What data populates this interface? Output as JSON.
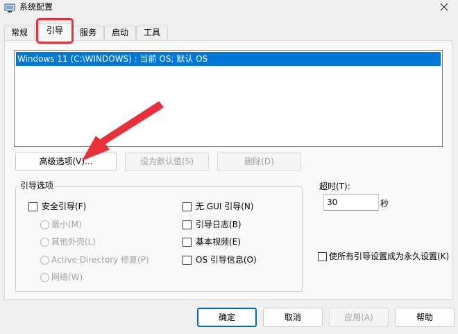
{
  "window": {
    "title": "系统配置"
  },
  "tabs": [
    {
      "label": "常规"
    },
    {
      "label": "引导"
    },
    {
      "label": "服务"
    },
    {
      "label": "启动"
    },
    {
      "label": "工具"
    }
  ],
  "boot_list": {
    "entries": [
      "Windows 11 (C:\\WINDOWS) : 当前 OS; 默认 OS"
    ]
  },
  "buttons": {
    "advanced": "高级选项(V)...",
    "set_default": "设为默认值(S)",
    "delete": "删除(D)"
  },
  "boot_options": {
    "title": "引导选项",
    "safe_boot": "安全引导(F)",
    "minimal": "最小(M)",
    "alternate_shell": "其他外壳(L)",
    "ad_repair": "Active Directory 修复(P)",
    "network": "网络(W)",
    "no_gui": "无 GUI 引导(N)",
    "boot_log": "引导日志(B)",
    "base_video": "基本视频(E)",
    "os_boot_info": "OS 引导信息(O)"
  },
  "timeout": {
    "label": "超时(T):",
    "value": "30",
    "unit": "秒"
  },
  "make_permanent": "使所有引导设置成为永久设置(K)",
  "footer": {
    "ok": "确定",
    "cancel": "取消",
    "apply": "应用(A)",
    "help": "帮助"
  },
  "colors": {
    "selection": "#0078d7",
    "annotation": "#e8303a"
  }
}
